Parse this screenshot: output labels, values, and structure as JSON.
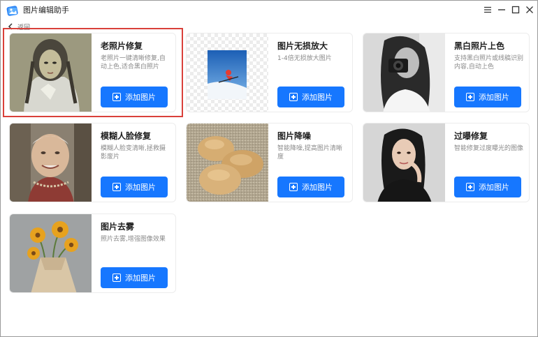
{
  "app": {
    "title": "图片编辑助手",
    "back_label": "返回",
    "window_controls": [
      "menu-icon",
      "minimize-icon",
      "maximize-icon",
      "close-icon"
    ]
  },
  "accent_color": "#1677ff",
  "highlight_color": "#d9403a",
  "cards": [
    {
      "id": "old-photo-restore",
      "title": "老照片修复",
      "desc": "老照片一键清晰修复,自动上色,适合黑白照片",
      "button": "添加图片",
      "thumb": "old-photo-girl"
    },
    {
      "id": "lossless-upscale",
      "title": "图片无损放大",
      "desc": "1-4倍无损放大图片",
      "button": "添加图片",
      "thumb": "skier"
    },
    {
      "id": "bw-colorize",
      "title": "黑白照片上色",
      "desc": "支持黑白照片或线稿识别内容,自动上色",
      "button": "添加图片",
      "thumb": "bw-camera-woman"
    },
    {
      "id": "face-restore",
      "title": "模糊人脸修复",
      "desc": "模糊人脸变清晰,拯救摄影废片",
      "button": "添加图片",
      "thumb": "old-woman"
    },
    {
      "id": "denoise",
      "title": "图片降噪",
      "desc": "智能降噪,提高图片清晰度",
      "button": "添加图片",
      "thumb": "bread-noise"
    },
    {
      "id": "overexposure-fix",
      "title": "过曝修复",
      "desc": "智能修复过度曝光的图像",
      "button": "添加图片",
      "thumb": "woman-black"
    },
    {
      "id": "dehaze",
      "title": "图片去雾",
      "desc": "照片去雾,增强图像效果",
      "button": "添加图片",
      "thumb": "sunflowers"
    }
  ]
}
